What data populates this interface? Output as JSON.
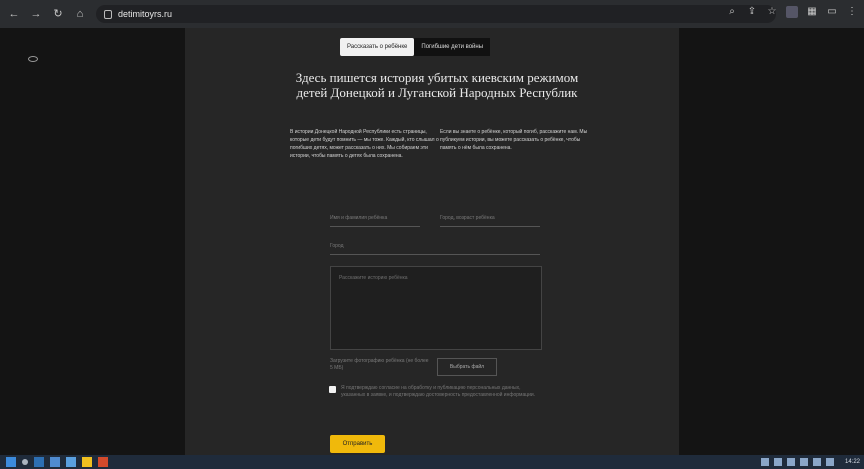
{
  "browser": {
    "url": "detimitoyrs.ru"
  },
  "tabs": [
    {
      "label": "Рассказать о ребёнке",
      "active": true
    },
    {
      "label": "Погибшие дети войны",
      "active": false
    }
  ],
  "title": "Здесь пишется история убитых киевским режимом детей Донецкой и Луганской Народных Республик",
  "description": {
    "left": "В истории Донецкой Народной Республики есть страницы, которые дети будут помнить — мы тоже. Каждый, кто слышал о погибших детях, может рассказать о них. Мы собираем эти истории, чтобы память о детях была сохранена.",
    "right": "Если вы знаете о ребёнке, который погиб, расскажите нам. Мы публикуем истории, вы можете рассказать о ребёнке, чтобы память о нём была сохранена."
  },
  "form": {
    "name_placeholder": "Имя и фамилия ребёнка",
    "agecity_placeholder": "Город, возраст ребёнка",
    "org_placeholder": "Город",
    "story_placeholder": "Расскажите историю ребёнка",
    "photo_label": "Загрузите фотографию ребёнка (не более 5 МБ)",
    "choose_file_label": "Выбрать файл",
    "consent_text": "Я подтверждаю согласие на обработку и публикацию персональных данных, указанных в заявке, и подтверждаю достоверность предоставленной информации.",
    "submit_label": "Отправить"
  },
  "taskbar": {
    "clock": "14:22"
  },
  "colors": {
    "accent": "#f0b90b",
    "page_bg": "#1a1a1a",
    "panel_bg": "#262626"
  }
}
